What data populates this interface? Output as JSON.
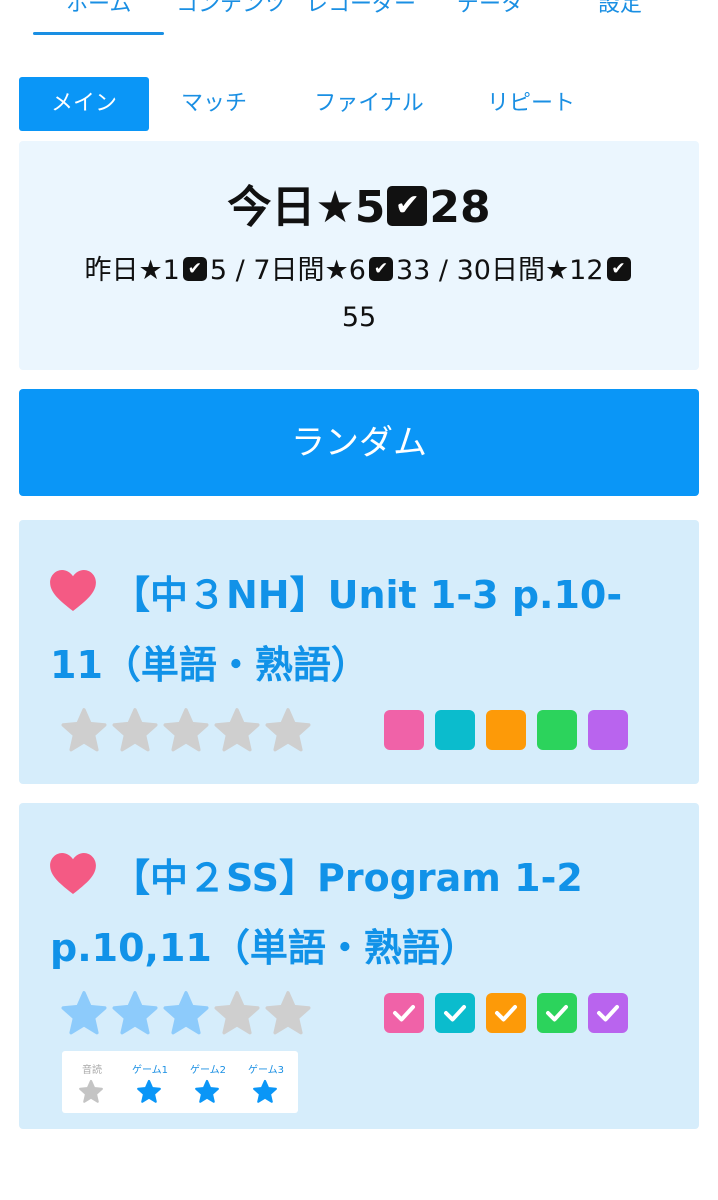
{
  "top_nav": {
    "items": [
      "ホーム",
      "コンテンツ",
      "レコーダー",
      "データ",
      "設定"
    ],
    "active_index": 0
  },
  "sub_tabs": {
    "items": [
      "メイン",
      "マッチ",
      "ファイナル",
      "リピート"
    ],
    "active_index": 0
  },
  "stats": {
    "today_label": "今日",
    "today_stars": "5",
    "today_checks": "28",
    "yesterday_label": "昨日",
    "yesterday_stars": "1",
    "yesterday_checks": "5",
    "week_label": "7日間",
    "week_stars": "6",
    "week_checks": "33",
    "month_label": "30日間",
    "month_stars": "12",
    "month_checks": "55",
    "separator": "/"
  },
  "random_button": {
    "label": "ランダム"
  },
  "cards": [
    {
      "title": "【中３NH】Unit 1-3 p.10-11（単語・熟語）",
      "favorite": true,
      "stars_filled": 0,
      "stars_total": 5,
      "boxes": [
        {
          "color": "#f062a8",
          "checked": false
        },
        {
          "color": "#0bbccd",
          "checked": false
        },
        {
          "color": "#fd9a08",
          "checked": false
        },
        {
          "color": "#2cd35c",
          "checked": false
        },
        {
          "color": "#b964ee",
          "checked": false
        }
      ]
    },
    {
      "title": "【中２SS】Program 1-2 p.10,11（単語・熟語）",
      "favorite": true,
      "stars_filled": 3,
      "stars_total": 5,
      "boxes": [
        {
          "color": "#f062a8",
          "checked": true
        },
        {
          "color": "#0bbccd",
          "checked": true
        },
        {
          "color": "#fd9a08",
          "checked": true
        },
        {
          "color": "#2cd35c",
          "checked": true
        },
        {
          "color": "#b964ee",
          "checked": true
        }
      ],
      "sub_panel": {
        "labels": [
          "音読",
          "ゲーム1",
          "ゲーム2",
          "ゲーム3"
        ],
        "filled": [
          false,
          true,
          true,
          true
        ]
      }
    }
  ],
  "colors": {
    "accent": "#0a96f7",
    "link": "#1a8fe3",
    "card_bg": "#d6edfb",
    "stats_bg": "#ebf6fe",
    "heart": "#f45a84",
    "star_filled": "#8dcbfb",
    "star_empty": "#cfcfcf",
    "mini_star_filled": "#0a96f7",
    "mini_star_empty": "#c4c4c4"
  }
}
